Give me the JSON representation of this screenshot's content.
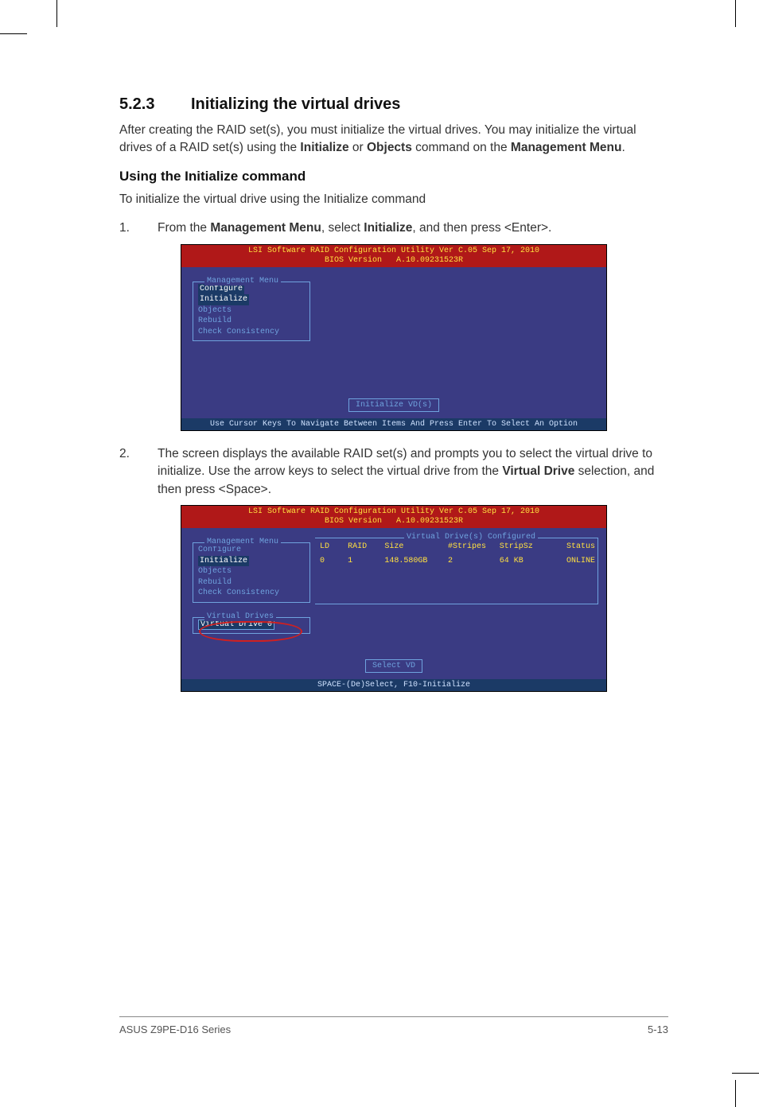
{
  "section": {
    "number": "5.2.3",
    "title": "Initializing the virtual drives"
  },
  "intro": {
    "p1_a": "After creating the RAID set(s), you must initialize the virtual drives. You may initialize the virtual drives of a RAID set(s) using the ",
    "p1_b1": "Initialize",
    "p1_c": " or ",
    "p1_b2": "Objects",
    "p1_d": " command on the ",
    "p1_b3": "Management Menu",
    "p1_e": "."
  },
  "sub": {
    "title": "Using the Initialize command",
    "lead": "To initialize the virtual drive using the Initialize command"
  },
  "steps": {
    "s1": {
      "n": "1.",
      "a": "From the ",
      "b1": "Management Menu",
      "c": ", select ",
      "b2": "Initialize",
      "d": ", and then press <Enter>."
    },
    "s2": {
      "n": "2.",
      "a": "The screen displays the available RAID set(s) and prompts you to select the virtual drive to initialize. Use the arrow keys to select the virtual drive from the ",
      "b1": "Virtual Drive",
      "c": " selection, and then press <Space>."
    }
  },
  "bios1": {
    "header": "LSI Software RAID Configuration Utility Ver C.05 Sep 17, 2010\nBIOS Version   A.10.09231523R",
    "menu_title": "Management Menu",
    "items": {
      "configure": "Configure",
      "initialize": "Initialize",
      "objects": "Objects",
      "rebuild": "Rebuild",
      "check": "Check Consistency"
    },
    "prompt": "Initialize VD(s)",
    "footer": "Use Cursor Keys To Navigate Between Items And Press Enter To Select An Option"
  },
  "bios2": {
    "header": "LSI Software RAID Configuration Utility Ver C.05 Sep 17, 2010\nBIOS Version   A.10.09231523R",
    "menu_title": "Management Menu",
    "items": {
      "configure": "Configure",
      "initialize": "Initialize",
      "objects": "Objects",
      "rebuild": "Rebuild",
      "check": "Check Consistency"
    },
    "vd_box_title": "Virtual Drive(s) Configured",
    "vd_cols": {
      "ld": "LD",
      "raid": "RAID",
      "size": "Size",
      "stripes": "#Stripes",
      "stripsz": "StripSz",
      "status": "Status"
    },
    "vd_row": {
      "ld": "0",
      "raid": "1",
      "size": "148.580GB",
      "stripes": "2",
      "stripsz": "64 KB",
      "status": "ONLINE"
    },
    "vd_sub_title": "Virtual Drives",
    "vd_sub_item": "Virtual Drive 0",
    "prompt": "Select VD",
    "footer": "SPACE-(De)Select,  F10-Initialize"
  },
  "footer": {
    "left": "ASUS Z9PE-D16 Series",
    "right": "5-13"
  }
}
